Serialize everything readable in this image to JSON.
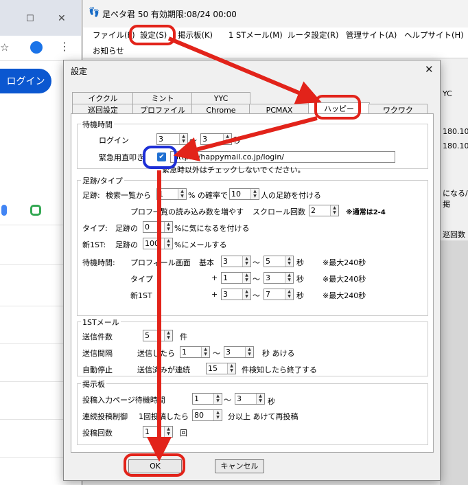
{
  "browser": {
    "login_label": "ログイン",
    "star_icon": "☆",
    "more_icon": "⋮",
    "close_icon": "✕",
    "max_icon": "☐"
  },
  "app": {
    "title": "足ペタ君 50 有効期限:08/24 00:00",
    "menu": [
      "ファイル(F)",
      "設定(S)",
      "掲示板(K)",
      "1 STメール(M)",
      "ルータ設定(R)",
      "管理サイト(A)",
      "ヘルプサイト(H)"
    ],
    "notice": "お知らせ",
    "bg_texts": [
      "YC",
      "180.105",
      "180.105",
      "になる/掲",
      "巡回数"
    ]
  },
  "dialog": {
    "title": "設定",
    "tabs_row1": [
      "イククル",
      "ミント",
      "YYC"
    ],
    "tabs_row2": [
      "巡回設定",
      "プロファイル",
      "Chrome",
      "PCMAX",
      "ハッピー",
      "ワクワク"
    ],
    "wait": {
      "group": "待機時間",
      "login_label": "ログイン",
      "login_min": "3",
      "tilde": "〜",
      "login_max": "3",
      "sec": "秒",
      "emergency_label": "緊急用直叩き",
      "emergency_url": "https://happymail.co.jp/login/",
      "emergency_note": "緊急時以外はチェックしないでください。"
    },
    "footprint": {
      "group": "足跡/タイプ",
      "row1_a": "足跡:",
      "row1_b": "検索一覧から",
      "row1_val1": "1",
      "row1_c": "% の確率で",
      "row1_val2": "10",
      "row1_d": "人の足跡を付ける",
      "row2_a": "プロフ一覧の読み込み数を増やす",
      "row2_b": "スクロール回数",
      "row2_val": "2",
      "row2_note": "※通常は2-4",
      "row3_a": "タイプ:",
      "row3_b": "足跡の",
      "row3_val": "0",
      "row3_c": "%に気になるを付ける",
      "row4_a": "新1ST:",
      "row4_b": "足跡の",
      "row4_val": "100",
      "row4_c": "%にメールする",
      "wait_label": "待機時間:",
      "profile_label": "プロフィール画面",
      "base_label": "基本",
      "p_min": "3",
      "p_max": "5",
      "p_sec": "秒",
      "p_note": "※最大240秒",
      "type_label": "タイプ",
      "plus": "+",
      "t_min": "1",
      "t_max": "3",
      "t_sec": "秒",
      "t_note": "※最大240秒",
      "new1st_label": "新1ST",
      "n_min": "3",
      "n_max": "7",
      "n_sec": "秒",
      "n_note": "※最大240秒"
    },
    "mail": {
      "group": "1STメール",
      "count_label": "送信件数",
      "count_val": "5",
      "count_unit": "件",
      "interval_label": "送信間隔",
      "interval_a": "送信したら",
      "i_min": "1",
      "i_max": "3",
      "interval_b": "秒 あける",
      "stop_label": "自動停止",
      "stop_a": "送信済みが連続",
      "stop_val": "15",
      "stop_b": "件検知したら終了する"
    },
    "board": {
      "group": "掲示板",
      "wait_label": "投稿入力ページ待機時間",
      "w_min": "1",
      "w_max": "3",
      "w_sec": "秒",
      "limit_label": "連続投稿制御",
      "limit_a": "1回投稿したら",
      "limit_val": "80",
      "limit_b": "分以上 あけて再投稿",
      "count_label": "投稿回数",
      "count_val": "1",
      "count_unit": "回"
    },
    "ok": "OK",
    "cancel": "キャンセル"
  },
  "colors": {
    "highlight_red": "#e2231a",
    "highlight_blue": "#1d2fd6",
    "checkbox": "#1f6fd1",
    "login_button": "#0b57d0"
  }
}
